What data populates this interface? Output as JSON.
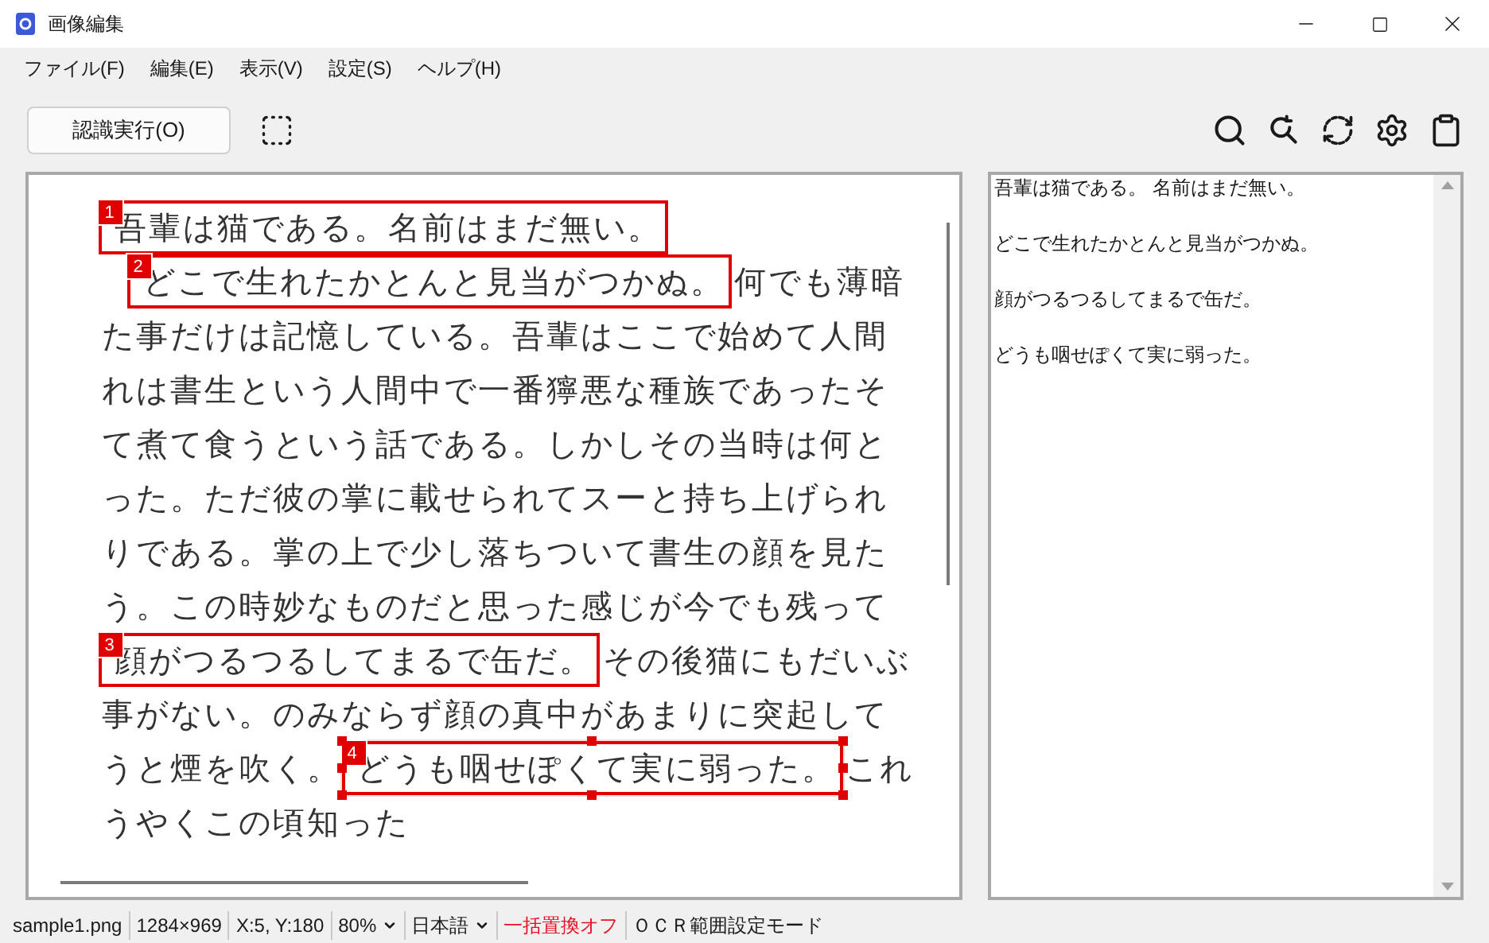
{
  "window": {
    "title": "画像編集"
  },
  "menu": [
    "ファイル(F)",
    "編集(E)",
    "表示(V)",
    "設定(S)",
    "ヘルプ(H)"
  ],
  "toolbar": {
    "run_button": "認識実行(O)"
  },
  "image_lines": [
    {
      "indented": false,
      "segments": [
        {
          "kind": "region",
          "number": "1",
          "selected": false,
          "text": "吾輩は猫である。名前はまだ無い。"
        }
      ]
    },
    {
      "indented": true,
      "segments": [
        {
          "kind": "region",
          "number": "2",
          "selected": false,
          "text": "どこで生れたかとんと見当がつかぬ。"
        },
        {
          "kind": "plain",
          "text": "何でも薄暗"
        }
      ]
    },
    {
      "indented": false,
      "segments": [
        {
          "kind": "plain",
          "text": "た事だけは記憶している。吾輩はここで始めて人間"
        }
      ]
    },
    {
      "indented": false,
      "segments": [
        {
          "kind": "plain",
          "text": "れは書生という人間中で一番獰悪な種族であったそ"
        }
      ]
    },
    {
      "indented": false,
      "segments": [
        {
          "kind": "plain",
          "text": "て煮て食うという話である。しかしその当時は何と"
        }
      ]
    },
    {
      "indented": false,
      "segments": [
        {
          "kind": "plain",
          "text": "った。ただ彼の掌に載せられてスーと持ち上げられ"
        }
      ]
    },
    {
      "indented": false,
      "segments": [
        {
          "kind": "plain",
          "text": "りである。掌の上で少し落ちついて書生の顔を見た"
        }
      ]
    },
    {
      "indented": false,
      "segments": [
        {
          "kind": "plain",
          "text": "う。この時妙なものだと思った感じが今でも残って"
        }
      ]
    },
    {
      "indented": false,
      "segments": [
        {
          "kind": "region",
          "number": "3",
          "selected": false,
          "text": "顔がつるつるしてまるで缶だ。"
        },
        {
          "kind": "plain",
          "text": "その後猫にもだいぶ"
        }
      ]
    },
    {
      "indented": false,
      "segments": [
        {
          "kind": "plain",
          "text": "事がない。のみならず顔の真中があまりに突起して"
        }
      ]
    },
    {
      "indented": false,
      "segments": [
        {
          "kind": "plain",
          "text": "うと煙を吹く。"
        },
        {
          "kind": "region",
          "number": "4",
          "selected": true,
          "text": "どうも咽せぽくて実に弱った。"
        },
        {
          "kind": "plain",
          "text": "これ"
        }
      ]
    },
    {
      "indented": false,
      "segments": [
        {
          "kind": "plain",
          "text": "うやくこの頃知った"
        }
      ]
    }
  ],
  "result_lines": [
    "吾輩は猫である。 名前はまだ無い。",
    "どこで生れたかとんと見当がつかぬ。",
    "顔がつるつるしてまるで缶だ。",
    "どうも咽せぽくて実に弱った。"
  ],
  "status_bar": [
    {
      "text": "sample1.png",
      "dropdown": false,
      "warning": false
    },
    {
      "text": "1284×969",
      "dropdown": false,
      "warning": false
    },
    {
      "text": "X:5, Y:180",
      "dropdown": false,
      "warning": false
    },
    {
      "text": "80%",
      "dropdown": true,
      "warning": false
    },
    {
      "text": "日本語",
      "dropdown": true,
      "warning": false
    },
    {
      "text": "一括置換オフ",
      "dropdown": false,
      "warning": true
    },
    {
      "text": "ＯＣＲ範囲設定モード",
      "dropdown": false,
      "warning": false
    }
  ]
}
